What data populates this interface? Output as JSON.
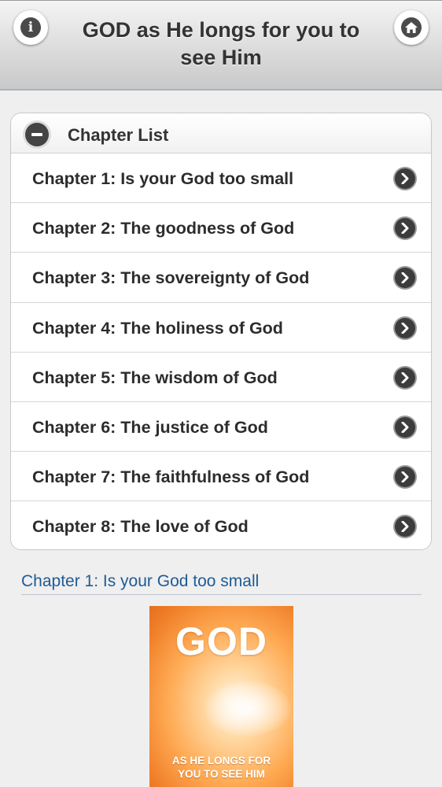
{
  "header": {
    "title": "GOD as He longs for you to see Him",
    "info_icon": "info-icon",
    "home_icon": "home-icon"
  },
  "chapter_panel": {
    "title": "Chapter List",
    "collapse_icon": "minus-circle-icon",
    "items": [
      {
        "label": "Chapter 1: Is your God too small"
      },
      {
        "label": "Chapter 2: The goodness of God"
      },
      {
        "label": "Chapter 3: The sovereignty of God"
      },
      {
        "label": "Chapter 4: The holiness of God"
      },
      {
        "label": "Chapter 5: The wisdom of God"
      },
      {
        "label": "Chapter 6: The justice of God"
      },
      {
        "label": "Chapter 7: The faithfulness of God"
      },
      {
        "label": "Chapter 8: The love of God"
      }
    ]
  },
  "content": {
    "section_title": "Chapter 1: Is your God too small",
    "cover": {
      "title": "GOD",
      "subtitle_line1": "AS HE LONGS FOR",
      "subtitle_line2": "YOU TO SEE HIM"
    }
  },
  "colors": {
    "accent_link": "#1f5b95",
    "header_text": "#333333",
    "background": "#efefef"
  }
}
